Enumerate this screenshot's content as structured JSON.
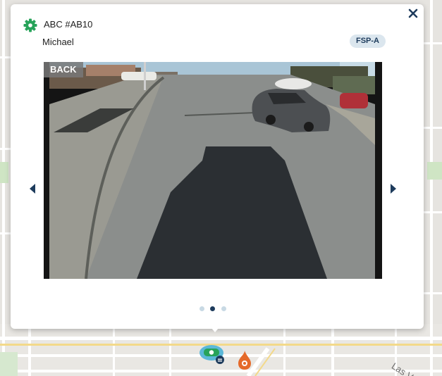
{
  "map": {
    "street_label": "Las V"
  },
  "popup": {
    "vehicle_title": "ABC #AB10",
    "driver_name": "Michael",
    "badge": "FSP-A",
    "close_icon": "close-icon",
    "vehicle_icon": "gear-icon",
    "vehicle_icon_color": "#27a35a"
  },
  "camera": {
    "view_label": "BACK"
  },
  "carousel": {
    "slide_count": 3,
    "active_slide": 2,
    "prev_icon": "chevron-left-icon",
    "next_icon": "chevron-right-icon"
  },
  "colors": {
    "accent": "#1d3b5c",
    "badge_bg": "#dbe6ee",
    "marker_green": "#27a35a",
    "marker_blue": "#5bb8d8",
    "marker_orange": "#e56a2a"
  }
}
